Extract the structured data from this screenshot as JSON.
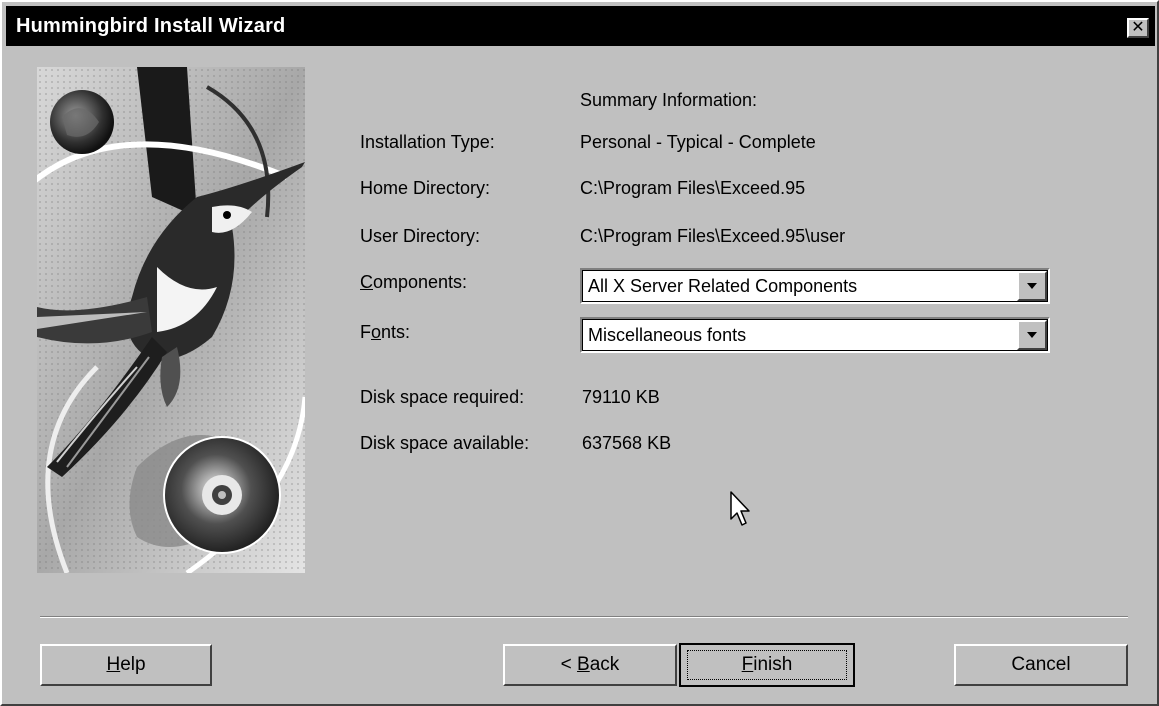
{
  "window": {
    "title": "Hummingbird Install Wizard",
    "close_glyph": "✕"
  },
  "summary": {
    "heading": "Summary Information:",
    "rows": [
      {
        "label": "Installation Type:",
        "value": "Personal - Typical - Complete"
      },
      {
        "label": "Home Directory:",
        "value": "C:\\Program Files\\Exceed.95"
      },
      {
        "label": "User Directory:",
        "value": "C:\\Program Files\\Exceed.95\\user"
      }
    ],
    "components": {
      "label_prefix": "",
      "label_accel": "C",
      "label_rest": "omponents:",
      "selected": "All X Server Related Components"
    },
    "fonts": {
      "label_prefix": "F",
      "label_accel": "o",
      "label_rest": "nts:",
      "selected": "Miscellaneous fonts"
    },
    "disk": [
      {
        "label": "Disk space required:",
        "value": "79110 KB"
      },
      {
        "label": "Disk space available:",
        "value": "637568 KB"
      }
    ]
  },
  "buttons": {
    "help": {
      "accel": "H",
      "rest": "elp"
    },
    "back": {
      "prefix": "< ",
      "accel": "B",
      "rest": "ack"
    },
    "finish": {
      "accel": "F",
      "rest": "inish"
    },
    "cancel": "Cancel"
  },
  "icons": {
    "side_image": "hummingbird-cd-illustration-icon",
    "combo_arrow": "chevron-down-icon",
    "cursor": "mouse-pointer-icon"
  }
}
